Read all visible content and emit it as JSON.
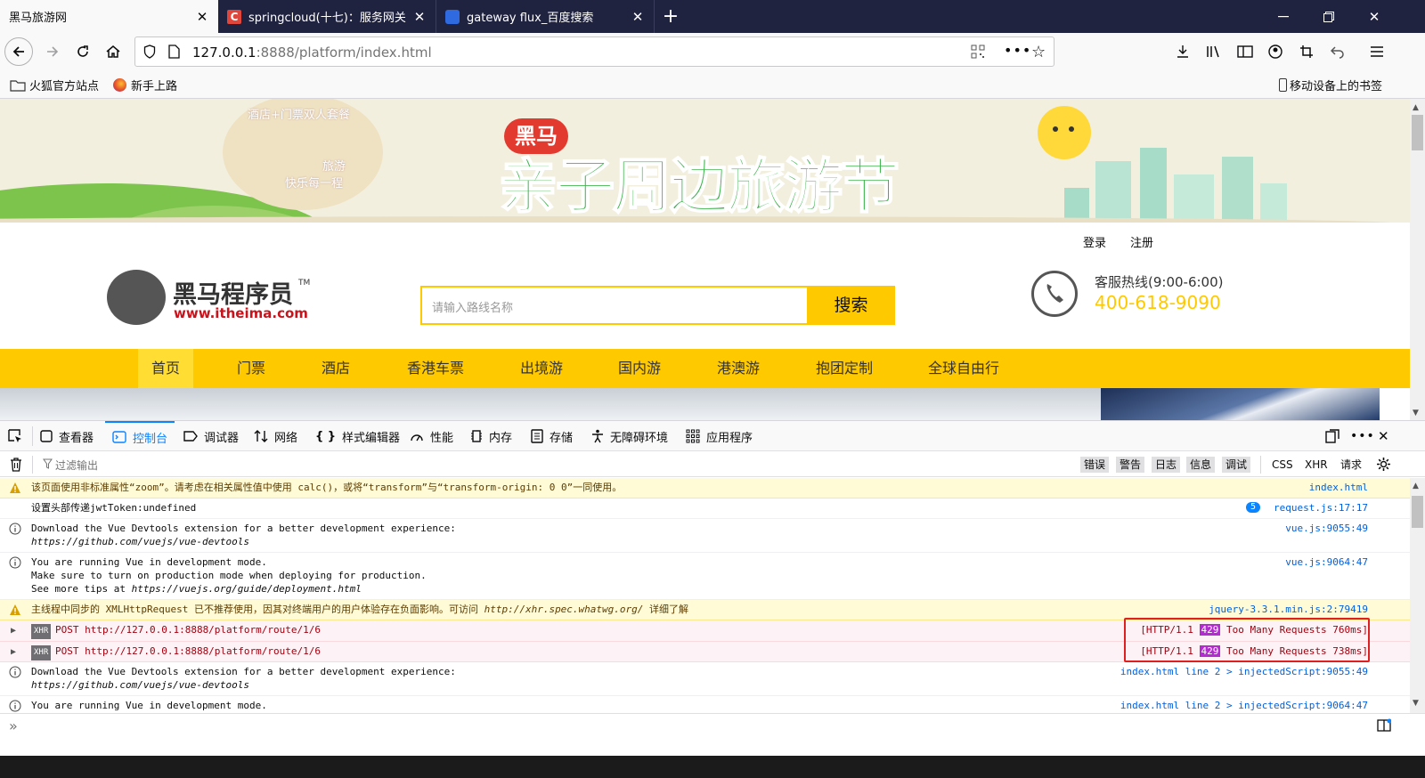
{
  "browser": {
    "tabs": [
      {
        "title": "黑马旅游网",
        "active": true
      },
      {
        "title": "springcloud(十七)：服务网关",
        "active": false
      },
      {
        "title": "gateway flux_百度搜索",
        "active": false
      }
    ],
    "url_host": "127.0.0.1",
    "url_rest": ":8888/platform/index.html",
    "bookmarks": [
      "火狐官方站点",
      "新手上路"
    ],
    "mobile_bookmarks": "移动设备上的书签"
  },
  "page": {
    "banner": {
      "small_text_1": "酒店+门票双人套餐",
      "small_text_2": "旅游",
      "small_text_3": "快乐每一程",
      "badge": "黑马",
      "headline": "亲子周边旅游节"
    },
    "header": {
      "login": "登录",
      "register": "注册",
      "logo_cn": "黑马程序员",
      "logo_tm": "TM",
      "logo_url": "www.itheima.com",
      "search_placeholder": "请输入路线名称",
      "search_button": "搜索",
      "hotline_label": "客服热线(9:00-6:00)",
      "hotline_number": "400-618-9090"
    },
    "nav": [
      "首页",
      "门票",
      "酒店",
      "香港车票",
      "出境游",
      "国内游",
      "港澳游",
      "抱团定制",
      "全球自由行"
    ]
  },
  "devtools": {
    "tabs": [
      "查看器",
      "控制台",
      "调试器",
      "网络",
      "样式编辑器",
      "性能",
      "内存",
      "存储",
      "无障碍环境",
      "应用程序"
    ],
    "selected_tab": "控制台",
    "filter_placeholder": "过滤输出",
    "filters": [
      "错误",
      "警告",
      "日志",
      "信息",
      "调试"
    ],
    "filters2": [
      "CSS",
      "XHR",
      "请求"
    ],
    "log": {
      "r1": {
        "msg": "该页面使用非标准属性“zoom”。请考虑在相关属性值中使用 calc()，或将“transform”与“transform-origin: 0 0”一同使用。",
        "src": "index.html"
      },
      "r2": {
        "msg": "设置头部传递jwtToken:undefined",
        "count": "5",
        "src": "request.js:17:17"
      },
      "r3": {
        "line1": "Download the Vue Devtools extension for a better development experience:",
        "line2": "https://github.com/vuejs/vue-devtools",
        "src": "vue.js:9055:49"
      },
      "r4": {
        "line1": "You are running Vue in development mode.",
        "line2": "Make sure to turn on production mode when deploying for production.",
        "line3a": "See more tips at ",
        "line3b": "https://vuejs.org/guide/deployment.html",
        "src": "vue.js:9064:47"
      },
      "r5": {
        "msg_a": "主线程中同步的 XMLHttpRequest 已不推荐使用，因其对终端用户的用户体验存在负面影响。可访问 ",
        "msg_link": "http://xhr.spec.whatwg.org/",
        "msg_b": " 详细了解",
        "src": "jquery-3.3.1.min.js:2:79419"
      },
      "r6": {
        "tag": "XHR",
        "msg": "POST http://127.0.0.1:8888/platform/route/1/6",
        "status_a": "[HTTP/1.1 ",
        "code": "429",
        "status_b": " Too Many Requests 760ms]"
      },
      "r7": {
        "tag": "XHR",
        "msg": "POST http://127.0.0.1:8888/platform/route/1/6",
        "status_a": "[HTTP/1.1 ",
        "code": "429",
        "status_b": " Too Many Requests 738ms]"
      },
      "r8": {
        "line1": "Download the Vue Devtools extension for a better development experience:",
        "line2": "https://github.com/vuejs/vue-devtools",
        "src": "index.html line 2 > injectedScript:9055:49"
      },
      "r9": {
        "line1": "You are running Vue in development mode.",
        "src": "index.html line 2 > injectedScript:9064:47"
      }
    },
    "prompt": "»"
  },
  "colors": {
    "accent_yellow": "#ffc900",
    "hotline": "#ffc900",
    "devtools_blue": "#0a84ff",
    "highlight_box": "#e02020"
  }
}
